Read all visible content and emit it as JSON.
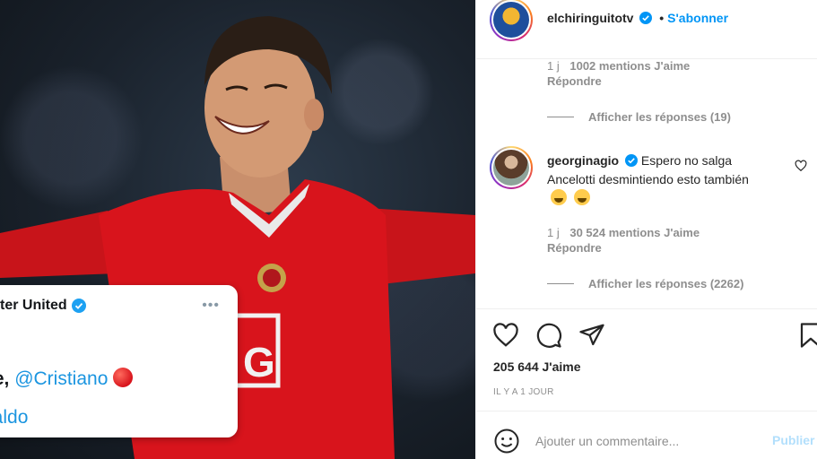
{
  "colors": {
    "accent": "#0095f6",
    "muted": "#8e8e8e",
    "jersey_red": "#d8141c"
  },
  "media": {
    "tweet": {
      "author_partial": "ter United",
      "more_label": "•••",
      "line1_prefix": "ue, ",
      "line1_mention": "@Cristiano",
      "line2": "naldo"
    }
  },
  "header": {
    "username": "elchiringuitotv",
    "dot": "•",
    "follow_label": "S'abonner"
  },
  "comments": [
    {
      "time": "1 j",
      "likes": "1002 mentions J'aime",
      "reply_label": "Répondre",
      "view_replies": "Afficher les réponses (19)"
    },
    {
      "username": "georginagio",
      "text": "Espero no salga Ancelotti desmintiendo esto también",
      "time": "1 j",
      "likes": "30 524 mentions J'aime",
      "reply_label": "Répondre",
      "view_replies": "Afficher les réponses (2262)"
    }
  ],
  "actions": {
    "icons": [
      "heart-icon",
      "comment-icon",
      "share-icon",
      "bookmark-icon"
    ],
    "likes": "205 644 J'aime",
    "date": "IL Y A 1 JOUR"
  },
  "add_comment": {
    "placeholder": "Ajouter un commentaire...",
    "publish_label": "Publier"
  }
}
